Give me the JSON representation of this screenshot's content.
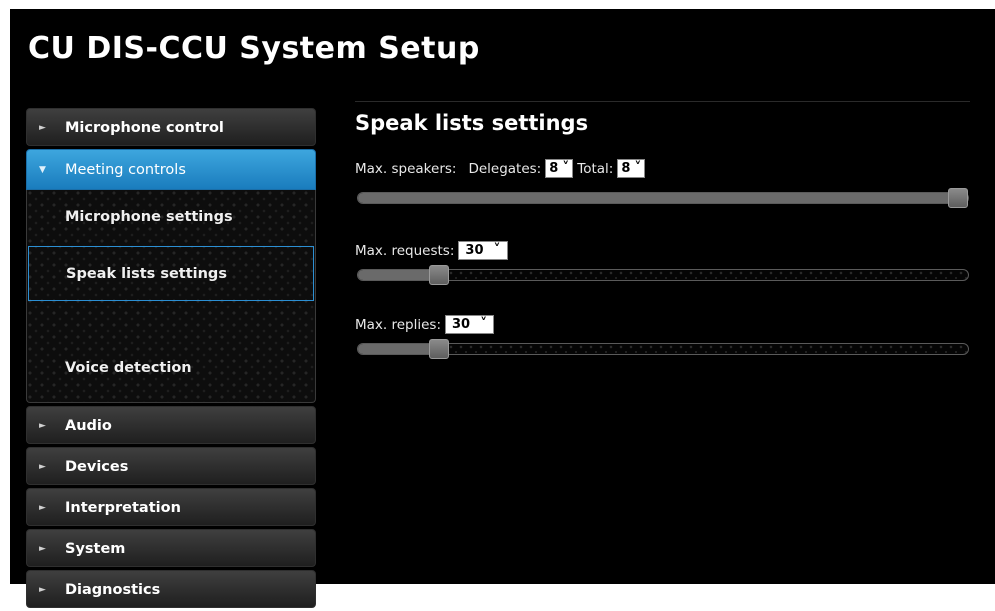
{
  "app": {
    "title": "CU DIS-CCU System Setup"
  },
  "nav": {
    "items": [
      {
        "label": "Microphone control",
        "expanded": false
      },
      {
        "label": "Meeting controls",
        "expanded": true,
        "children": [
          {
            "label": "Microphone settings"
          },
          {
            "label": "Speak lists settings",
            "selected": true
          },
          {
            "label": "Voice detection"
          }
        ]
      },
      {
        "label": "Audio",
        "expanded": false
      },
      {
        "label": "Devices",
        "expanded": false
      },
      {
        "label": "Interpretation",
        "expanded": false
      },
      {
        "label": "System",
        "expanded": false
      },
      {
        "label": "Diagnostics",
        "expanded": false
      }
    ]
  },
  "panel": {
    "heading": "Speak lists settings",
    "max_speakers": {
      "label": "Max. speakers:",
      "delegates_label": "Delegates:",
      "delegates_value": "8",
      "total_label": "Total:",
      "total_value": "8",
      "slider_level": 1.0
    },
    "max_requests": {
      "label": "Max. requests:",
      "value": "30",
      "slider_level": 0.12
    },
    "max_replies": {
      "label": "Max. replies:",
      "value": "30",
      "slider_level": 0.12
    }
  },
  "colors": {
    "background": "#000000",
    "active_nav": "#2a8fd0",
    "selected_border": "#2c8fd3",
    "slider_fill": "#6a6a6a"
  }
}
